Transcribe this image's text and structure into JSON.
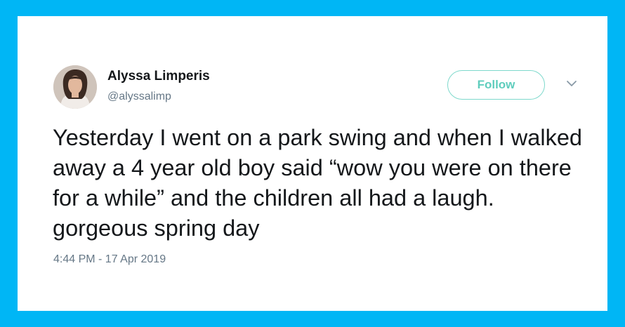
{
  "author": {
    "name": "Alyssa Limperis",
    "handle": "@alyssalimp"
  },
  "follow_button": {
    "label": "Follow"
  },
  "tweet": {
    "text": "Yesterday I went on a park swing and when I walked away a 4 year old boy said “wow you were on there for a while” and the children all had a laugh. gorgeous spring day",
    "timestamp": "4:44 PM - 17 Apr 2019"
  },
  "icons": {
    "menu": "chevron-down-icon",
    "avatar": "avatar"
  },
  "colors": {
    "background": "#00b6f5",
    "card": "#ffffff",
    "follow_accent": "#5fcdbd",
    "secondary_text": "#657786"
  }
}
